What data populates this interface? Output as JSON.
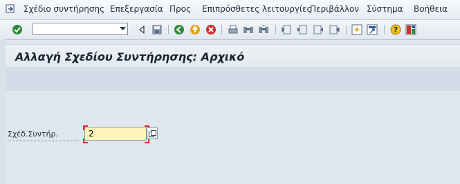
{
  "menu": {
    "items": [
      {
        "label": "Σχέδιο συντήρησης"
      },
      {
        "label": "Επεξεργασία"
      },
      {
        "label": "Προς"
      },
      {
        "label": "Επιπρόσθετες λειτουργίες"
      },
      {
        "label": "Περιβάλλον"
      },
      {
        "label": "Σύστημα"
      },
      {
        "label": "Βοήθεια"
      }
    ]
  },
  "toolbar": {
    "command_value": ""
  },
  "page": {
    "title": "Αλλαγή Σχεδίου Συντήρησης: Αρχικό"
  },
  "form": {
    "plan_label": "Σχέδ.Συντήρ.",
    "plan_value": "2"
  },
  "colors": {
    "required_field_bg": "#fff5b8",
    "required_marker": "#d42a2a",
    "background": "#dfe6ee"
  }
}
